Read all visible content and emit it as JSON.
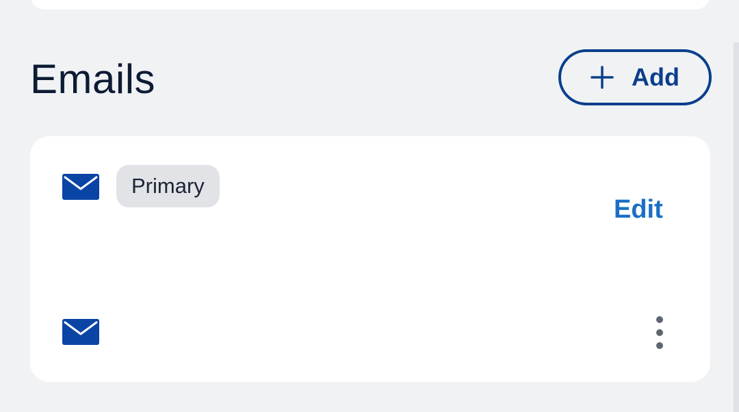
{
  "section": {
    "title": "Emails",
    "add_label": "Add"
  },
  "emails": [
    {
      "badge": "Primary",
      "address": "",
      "action_label": "Edit",
      "icon": "mail-icon"
    },
    {
      "badge": "",
      "address": "",
      "action_icon": "more-vertical-icon",
      "icon": "mail-icon"
    }
  ],
  "colors": {
    "background": "#f0f2f4",
    "card": "#ffffff",
    "title": "#0d1b33",
    "brand_blue": "#0b3f8c",
    "mail_icon": "#0a45a6",
    "link_blue": "#1a6fc4",
    "badge_bg": "#e1e3e7",
    "more_icon": "#5f6670"
  }
}
